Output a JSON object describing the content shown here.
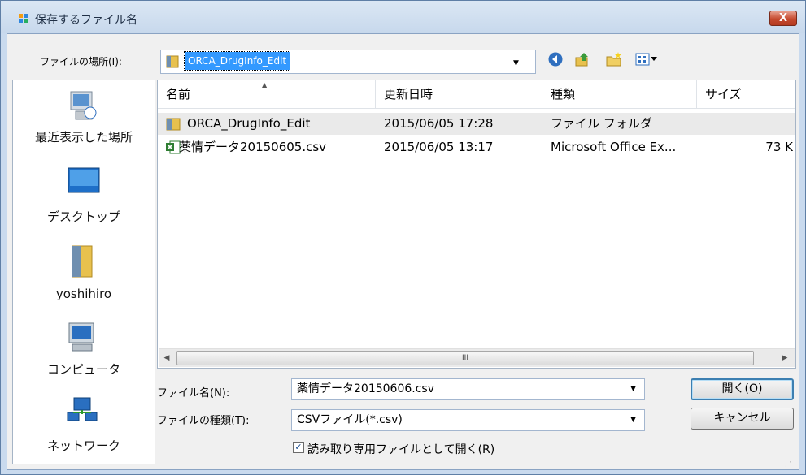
{
  "window": {
    "title": "保存するファイル名",
    "close_label": "X"
  },
  "lookin": {
    "label": "ファイルの場所(I):",
    "value": "ORCA_DrugInfo_Edit"
  },
  "toolbar": {
    "icons": [
      "back-icon",
      "up-folder-icon",
      "new-folder-icon",
      "view-menu-icon"
    ]
  },
  "places": [
    {
      "label": "最近表示した場所",
      "icon": "recent-places-icon"
    },
    {
      "label": "デスクトップ",
      "icon": "desktop-icon"
    },
    {
      "label": "yoshihiro",
      "icon": "user-folder-icon"
    },
    {
      "label": "コンピュータ",
      "icon": "computer-icon"
    },
    {
      "label": "ネットワーク",
      "icon": "network-icon"
    }
  ],
  "filelist": {
    "columns": [
      "名前",
      "更新日時",
      "種類",
      "サイズ"
    ],
    "rows": [
      {
        "name": "ORCA_DrugInfo_Edit",
        "modified": "2015/06/05 17:28",
        "type": "ファイル フォルダ",
        "size": "",
        "icon": "folder-icon"
      },
      {
        "name": "薬情データ20150605.csv",
        "modified": "2015/06/05 13:17",
        "type": "Microsoft Office Ex...",
        "size": "73 K",
        "icon": "excel-csv-icon"
      }
    ],
    "scroll_thumb_label": "III"
  },
  "bottom": {
    "filename_label": "ファイル名(N):",
    "filename_value": "薬情データ20150606.csv",
    "filetype_label": "ファイルの種類(T):",
    "filetype_value": "CSVファイル(*.csv)",
    "readonly_label": "読み取り専用ファイルとして開く(R)",
    "readonly_checked": true,
    "open_button": "開く(O)",
    "cancel_button": "キャンセル"
  }
}
